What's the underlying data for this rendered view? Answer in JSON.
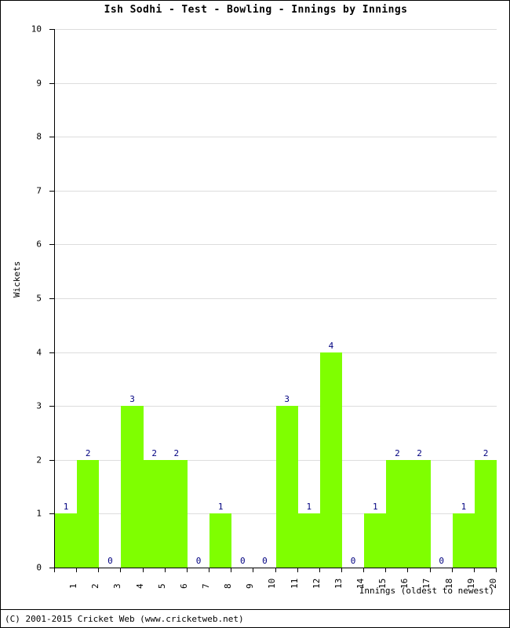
{
  "chart_data": {
    "type": "bar",
    "title": "Ish Sodhi - Test - Bowling - Innings by Innings",
    "xlabel": "Innings (oldest to newest)",
    "ylabel": "Wickets",
    "categories": [
      "1",
      "2",
      "3",
      "4",
      "5",
      "6",
      "7",
      "8",
      "9",
      "10",
      "11",
      "12",
      "13",
      "14",
      "15",
      "16",
      "17",
      "18",
      "19",
      "20"
    ],
    "values": [
      1,
      2,
      0,
      3,
      2,
      2,
      0,
      1,
      0,
      0,
      3,
      1,
      4,
      0,
      1,
      2,
      2,
      0,
      1,
      2
    ],
    "value_labels": [
      "1",
      "2",
      "0",
      "3",
      "2",
      "2",
      "0",
      "1",
      "0",
      "0",
      "3",
      "1",
      "4",
      "0",
      "1",
      "2",
      "2",
      "0",
      "1",
      "2"
    ],
    "ylim": [
      0,
      10
    ],
    "ytick_step": 1,
    "yticks": [
      "0",
      "1",
      "2",
      "3",
      "4",
      "5",
      "6",
      "7",
      "8",
      "9",
      "10"
    ],
    "grid": true,
    "legend": null,
    "bar_color": "#7fff00",
    "value_label_color": "#000080",
    "gridline_color": "#dddddd",
    "axis_color": "#000000"
  },
  "footer": {
    "copyright": "(C) 2001-2015 Cricket Web (www.cricketweb.net)"
  }
}
